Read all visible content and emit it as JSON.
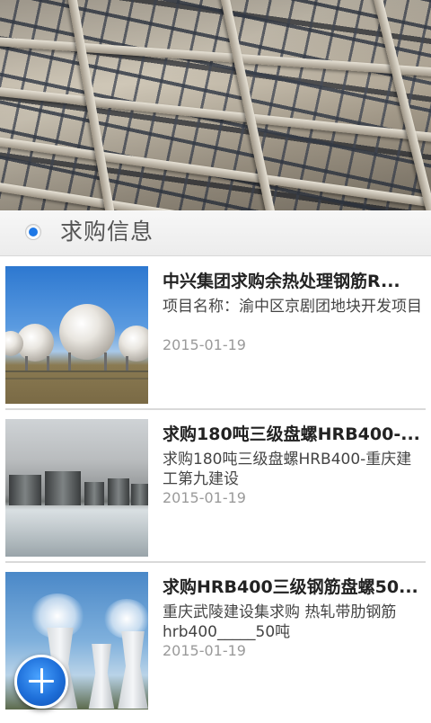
{
  "section": {
    "title": "求购信息"
  },
  "items": [
    {
      "title": "中兴集团求购余热处理钢筋R...",
      "desc": "项目名称：渝中区京剧团地块开发项目",
      "date": "2015-01-19"
    },
    {
      "title": "求购180吨三级盘螺HRB400-...",
      "desc": "求购180吨三级盘螺HRB400-重庆建工第九建设",
      "date": "2015-01-19"
    },
    {
      "title": "求购HRB400三级钢筋盘螺50...",
      "desc": "重庆武陵建设集求购 热轧带肋钢筋hrb400_____50吨",
      "date": "2015-01-19"
    }
  ],
  "icons": {
    "fab": "plus-icon",
    "radio": "radio-selected-icon"
  },
  "colors": {
    "accent": "#1e78e6",
    "title_text": "#222222",
    "date_text": "#9a9a9a"
  }
}
